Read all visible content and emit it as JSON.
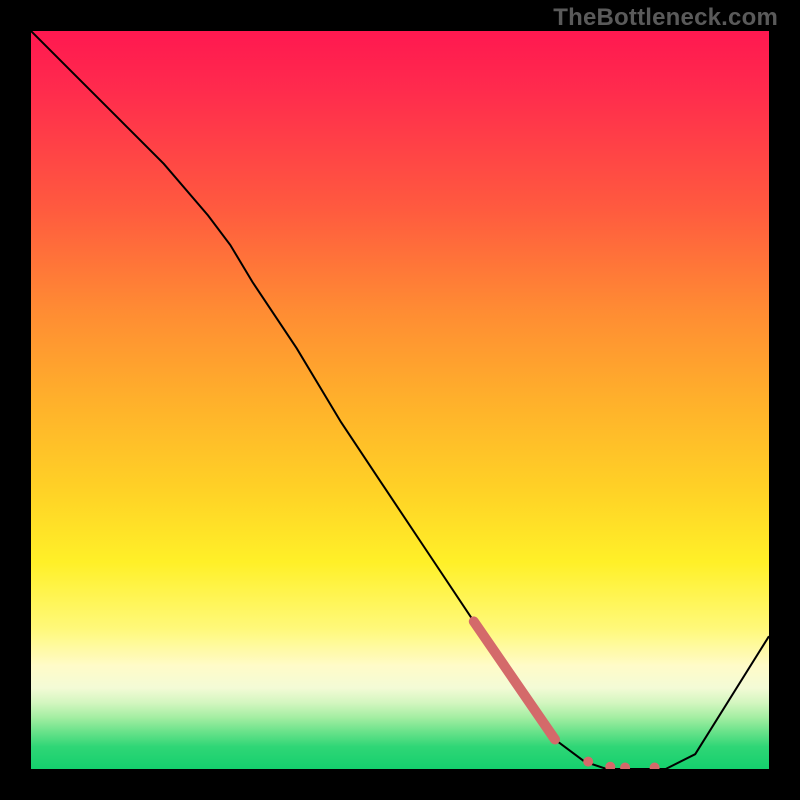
{
  "watermark": "TheBottleneck.com",
  "chart_data": {
    "type": "line",
    "title": "",
    "xlabel": "",
    "ylabel": "",
    "xlim": [
      0,
      100
    ],
    "ylim": [
      0,
      100
    ],
    "grid": false,
    "series": [
      {
        "name": "curve",
        "color": "#000000",
        "stroke_width": 2,
        "x": [
          0,
          6,
          12,
          18,
          24,
          27,
          30,
          36,
          42,
          48,
          54,
          60,
          66,
          71,
          75,
          78,
          82,
          86,
          90,
          100
        ],
        "y": [
          100,
          94,
          88,
          82,
          75,
          71,
          66,
          57,
          47,
          38,
          29,
          20,
          11,
          4,
          1,
          0,
          0,
          0,
          2,
          18
        ]
      },
      {
        "name": "highlight-segment",
        "color": "#d46a6a",
        "stroke_width": 10,
        "linecap": "round",
        "x": [
          60,
          71
        ],
        "y": [
          20,
          4
        ]
      }
    ],
    "markers": [
      {
        "name": "dot-1",
        "x": 75.5,
        "y": 1.0,
        "r": 5,
        "color": "#d46a6a"
      },
      {
        "name": "dot-2",
        "x": 78.5,
        "y": 0.3,
        "r": 5,
        "color": "#d46a6a"
      },
      {
        "name": "dot-3",
        "x": 80.5,
        "y": 0.2,
        "r": 5,
        "color": "#d46a6a"
      },
      {
        "name": "dot-4",
        "x": 84.5,
        "y": 0.2,
        "r": 5,
        "color": "#d46a6a"
      }
    ],
    "background_gradient": {
      "direction": "vertical",
      "stops": [
        {
          "pos": 0,
          "color": "#ff1850"
        },
        {
          "pos": 50,
          "color": "#ffb02b"
        },
        {
          "pos": 80,
          "color": "#fff97a"
        },
        {
          "pos": 100,
          "color": "#14d06d"
        }
      ]
    }
  }
}
